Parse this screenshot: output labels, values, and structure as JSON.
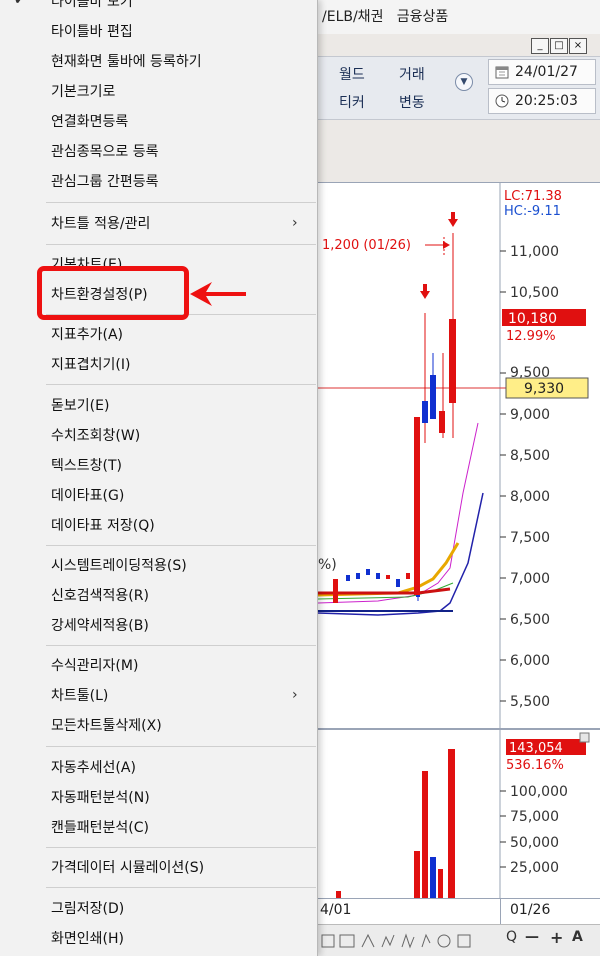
{
  "window": {
    "title": "/ELB/채권   금융상품",
    "buttons": [
      "_",
      "□",
      "×"
    ]
  },
  "toolbar": {
    "world_ticker_line1": "월드",
    "world_ticker_line2": "티커",
    "trade_change_line1": "거래",
    "trade_change_line2": "변동",
    "date": "24/01/27",
    "time": "20:25:03"
  },
  "chart": {
    "lc_label": "LC:71.38",
    "hc_label": "HC:-9.11",
    "high_annotation": "1,200 (01/26)",
    "price_badge": "10,180",
    "price_change": "12.99%",
    "current_price": "9,330",
    "partial_label": "%)",
    "price_ticks": [
      "11,000",
      "10,500",
      "9,500",
      "9,000",
      "8,500",
      "8,000",
      "7,500",
      "7,000",
      "6,500",
      "6,000",
      "5,500"
    ],
    "volume_badge": "143,054",
    "volume_change": "536.16%",
    "volume_ticks": [
      "100,000",
      "75,000",
      "50,000",
      "25,000"
    ],
    "date_left": "4/01",
    "date_right": "01/26",
    "tool_labels": [
      "Q",
      "—",
      "+",
      "A"
    ]
  },
  "menu": {
    "top_partial": "타이틀바 보기",
    "items": [
      {
        "label": "타이틀바 편집"
      },
      {
        "label": "현재화면 툴바에 등록하기"
      },
      {
        "label": "기본크기로"
      },
      {
        "label": "연결화면등록"
      },
      {
        "label": "관심종목으로 등록"
      },
      {
        "label": "관심그룹 간편등록"
      },
      {
        "label": "차트틀 적용/관리",
        "submenu": true
      },
      {
        "label": "기본차트(E)"
      },
      {
        "label": "차트환경설정(P)"
      },
      {
        "label": "지표추가(A)"
      },
      {
        "label": "지표겹치기(I)"
      },
      {
        "label": "돋보기(E)"
      },
      {
        "label": "수치조회창(W)"
      },
      {
        "label": "텍스트창(T)"
      },
      {
        "label": "데이타표(G)"
      },
      {
        "label": "데이타표 저장(Q)"
      },
      {
        "label": "시스템트레이딩적용(S)"
      },
      {
        "label": "신호검색적용(R)"
      },
      {
        "label": "강세약세적용(B)"
      },
      {
        "label": "수식관리자(M)"
      },
      {
        "label": "차트툴(L)",
        "submenu": true
      },
      {
        "label": "모든차트툴삭제(X)"
      },
      {
        "label": "자동추세선(A)"
      },
      {
        "label": "자동패턴분석(N)"
      },
      {
        "label": "캔들패턴분석(C)"
      },
      {
        "label": "가격데이터 시뮬레이션(S)"
      },
      {
        "label": "그림저장(D)"
      },
      {
        "label": "화면인쇄(H)"
      }
    ],
    "submenu_arrow": "›",
    "check_mark": "✔"
  },
  "colors": {
    "accent_red": "#ee1111",
    "rise_red": "#e01010",
    "fall_blue": "#1030d0",
    "price_badge_bg": "#e01010",
    "current_price_bg": "#ffee88"
  }
}
